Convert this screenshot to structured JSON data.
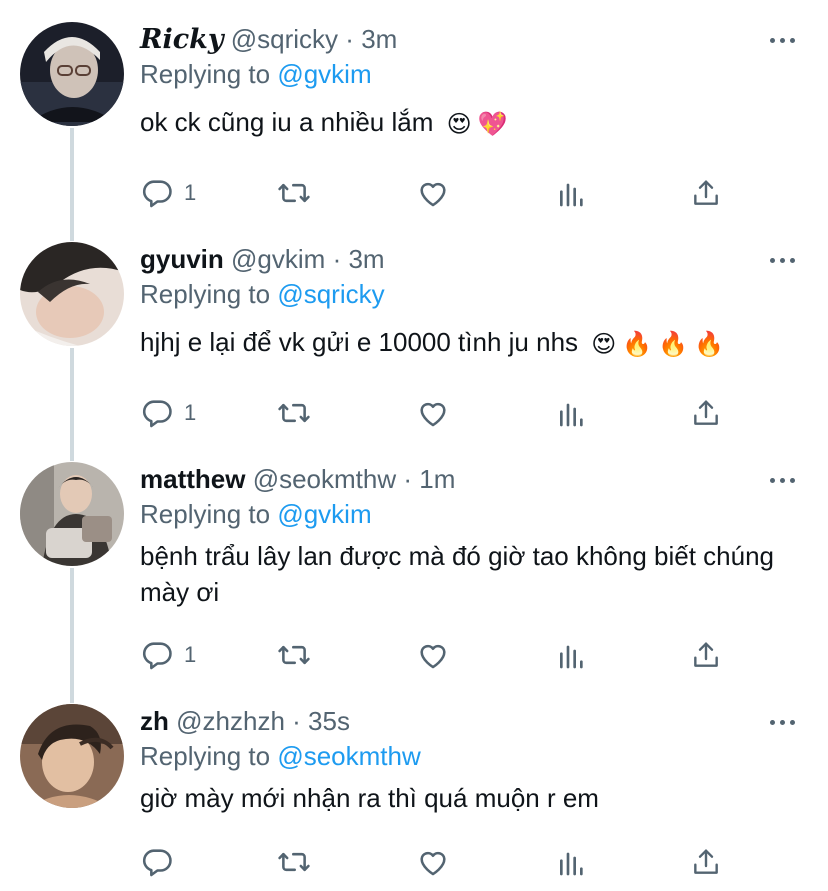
{
  "tweets": [
    {
      "name": "Ricky",
      "handle": "@sqricky",
      "separator": "·",
      "time": "3m",
      "replying_prefix": "Replying to",
      "replying_to": "@gvkim",
      "text": "ok ck cũng iu a nhiều lắm",
      "emojis": [
        "😍",
        "💖"
      ],
      "reply_count": "1"
    },
    {
      "name": "gyuvin",
      "handle": "@gvkim",
      "separator": "·",
      "time": "3m",
      "replying_prefix": "Replying to",
      "replying_to": "@sqricky",
      "text": "hjhj e lại để vk gửi e 10000 tình ju nhs",
      "emojis": [
        "😍",
        "🔥",
        "🔥",
        "🔥"
      ],
      "reply_count": "1"
    },
    {
      "name": "matthew",
      "handle": "@seokmthw",
      "separator": "·",
      "time": "1m",
      "replying_prefix": "Replying to",
      "replying_to": "@gvkim",
      "text": "bệnh trẩu lây lan được mà đó giờ tao không biết chúng mày ơi",
      "emojis": [],
      "reply_count": "1"
    },
    {
      "name": "zh",
      "handle": "@zhzhzh",
      "separator": "·",
      "time": "35s",
      "replying_prefix": "Replying to",
      "replying_to": "@seokmthw",
      "text": "giờ mày mới nhận ra thì quá muộn r em",
      "emojis": [],
      "reply_count": ""
    }
  ],
  "icons": {
    "reply": "reply-icon",
    "retweet": "retweet-icon",
    "like": "heart-icon",
    "analytics": "analytics-icon",
    "share": "share-icon",
    "more": "more-icon"
  },
  "colors": {
    "text": "#0f1419",
    "secondary": "#536471",
    "link": "#1d9bf0",
    "thread_line": "#cfd9de"
  }
}
